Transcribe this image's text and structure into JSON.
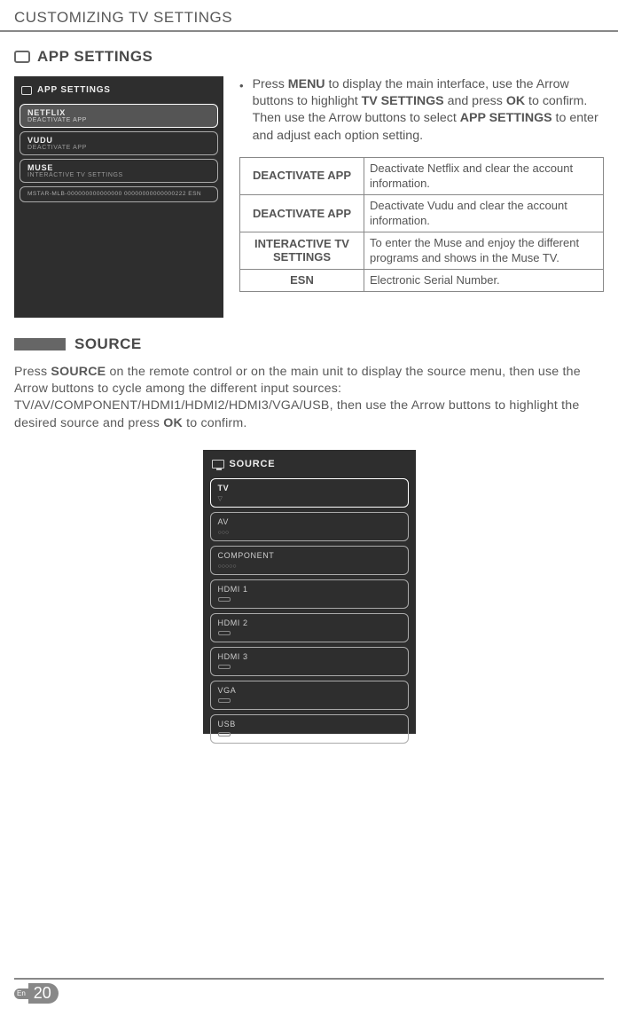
{
  "page_header": "CUSTOMIZING TV SETTINGS",
  "section1": {
    "title": "APP SETTINGS",
    "screenshot": {
      "heading": "APP SETTINGS",
      "items": [
        {
          "title": "NETFLIX",
          "sub": "DEACTIVATE APP",
          "selected": true
        },
        {
          "title": "VUDU",
          "sub": "DEACTIVATE APP",
          "selected": false
        },
        {
          "title": "MUSE",
          "sub": "INTERACTIVE TV SETTINGS",
          "selected": false
        }
      ],
      "esn": "MSTAR-MLB-000000000000000\n00000000000000222\nESN"
    },
    "instruction": {
      "pre": "Press ",
      "b1": "MENU",
      "m1": " to display the main interface, use the Arrow buttons to highlight ",
      "b2": "TV SETTINGS",
      "m2": " and press ",
      "b3": "OK",
      "m3": " to confirm. Then use the Arrow buttons to select ",
      "b4": "APP SETTINGS",
      "m4": " to enter and adjust each option setting."
    },
    "table": [
      {
        "k": "DEACTIVATE APP",
        "v": "Deactivate Netflix and clear the account information."
      },
      {
        "k": "DEACTIVATE APP",
        "v": "Deactivate Vudu and clear the account information."
      },
      {
        "k": "INTERACTIVE TV SETTINGS",
        "v": "To enter the Muse and enjoy the different programs and shows in the Muse TV."
      },
      {
        "k": "ESN",
        "v": "Electronic Serial Number."
      }
    ]
  },
  "section2": {
    "title": "SOURCE",
    "para_pre": "Press ",
    "para_b1": "SOURCE",
    "para_m1": " on the remote control or on the main unit to display the source menu, then use the Arrow buttons to cycle among the different input sources: TV/AV/COMPONENT/HDMI1/HDMI2/HDMI3/VGA/USB, then use the Arrow buttons to highlight the desired source and press ",
    "para_b2": "OK",
    "para_m2": " to confirm.",
    "screenshot": {
      "heading": "SOURCE",
      "items": [
        {
          "label": "TV",
          "sel": true
        },
        {
          "label": "AV",
          "sel": false
        },
        {
          "label": "COMPONENT",
          "sel": false
        },
        {
          "label": "HDMI 1",
          "sel": false
        },
        {
          "label": "HDMI 2",
          "sel": false
        },
        {
          "label": "HDMI 3",
          "sel": false
        },
        {
          "label": "VGA",
          "sel": false
        },
        {
          "label": "USB",
          "sel": false
        }
      ]
    }
  },
  "footer": {
    "lang": "En",
    "page": "20"
  }
}
